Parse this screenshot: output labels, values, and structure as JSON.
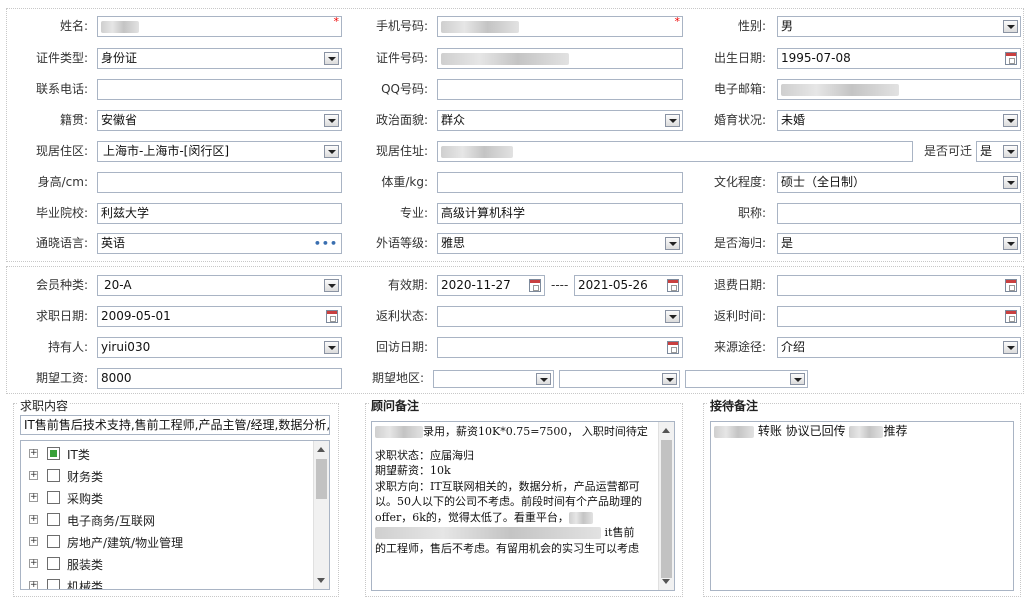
{
  "personal": {
    "name_label": "姓名:",
    "phone_label": "手机号码:",
    "gender_label": "性别:",
    "gender_value": "男",
    "id_type_label": "证件类型:",
    "id_type_value": "身份证",
    "id_no_label": "证件号码:",
    "birth_label": "出生日期:",
    "birth_value": "1995-07-08",
    "tel_label": "联系电话:",
    "qq_label": "QQ号码:",
    "email_label": "电子邮箱:",
    "native_label": "籍贯:",
    "native_value": "安徽省",
    "political_label": "政治面貌:",
    "political_value": "群众",
    "marital_label": "婚育状况:",
    "marital_value": "未婚",
    "residence_area_label": "现居住区:",
    "residence_area_value": "上海市-上海市-[闵行区]",
    "address_label": "现居住址:",
    "relocate_label": "是否可迁",
    "relocate_value": "是",
    "height_label": "身高/cm:",
    "weight_label": "体重/kg:",
    "education_label": "文化程度:",
    "education_value": "硕士（全日制）",
    "school_label": "毕业院校:",
    "school_value": "利兹大学",
    "major_label": "专业:",
    "major_value": "高级计算机科学",
    "title_label": "职称:",
    "language_label": "通晓语言:",
    "language_value": "英语",
    "language_more": "•••",
    "lang_level_label": "外语等级:",
    "lang_level_value": "雅思",
    "overseas_label": "是否海归:",
    "overseas_value": "是",
    "required_mark": "*"
  },
  "membership": {
    "member_type_label": "会员种类:",
    "member_type_value": "20-A",
    "valid_label": "有效期:",
    "valid_from": "2020-11-27",
    "valid_sep": "----",
    "valid_to": "2021-05-26",
    "refund_date_label": "退费日期:",
    "job_date_label": "求职日期:",
    "job_date_value": "2009-05-01",
    "rebate_status_label": "返利状态:",
    "rebate_time_label": "返利时间:",
    "holder_label": "持有人:",
    "holder_value": "yirui030",
    "revisit_label": "回访日期:",
    "source_label": "来源途径:",
    "source_value": "介绍",
    "salary_label": "期望工资:",
    "salary_value": "8000",
    "region_label": "期望地区:"
  },
  "job_intent": {
    "title": "求职内容",
    "summary": "IT售前售后技术支持,售前工程师,产品主管/经理,数据分析,",
    "tree": [
      {
        "label": "IT类",
        "checked": true
      },
      {
        "label": "财务类",
        "checked": false
      },
      {
        "label": "采购类",
        "checked": false
      },
      {
        "label": "电子商务/互联网",
        "checked": false
      },
      {
        "label": "房地产/建筑/物业管理",
        "checked": false
      },
      {
        "label": "服装类",
        "checked": false
      },
      {
        "label": "机械类",
        "checked": false
      }
    ]
  },
  "consultant_note": {
    "title": "顾问备注",
    "line1": "录用，薪资10K*0.75=7500，  入职时间待定",
    "line2": "求职状态：应届海归",
    "line3": "期望薪资：10k",
    "line4": "求职方向：IT互联网相关的，数据分析，产品运营都可以。50人以下的公司不考虑。前段时间有个产品助理的offer，6k的，觉得太低了。看重平台，",
    "line5": "it售前",
    "line6": "的工程师，售后不考虑。有留用机会的实习生可以考虑"
  },
  "reception_note": {
    "title": "接待备注",
    "part1": "转账 协议已回传",
    "part2": "推荐"
  },
  "colors": {
    "border": "#a9b4c4",
    "required": "#e00000",
    "tree_check": "#3aa03a"
  }
}
